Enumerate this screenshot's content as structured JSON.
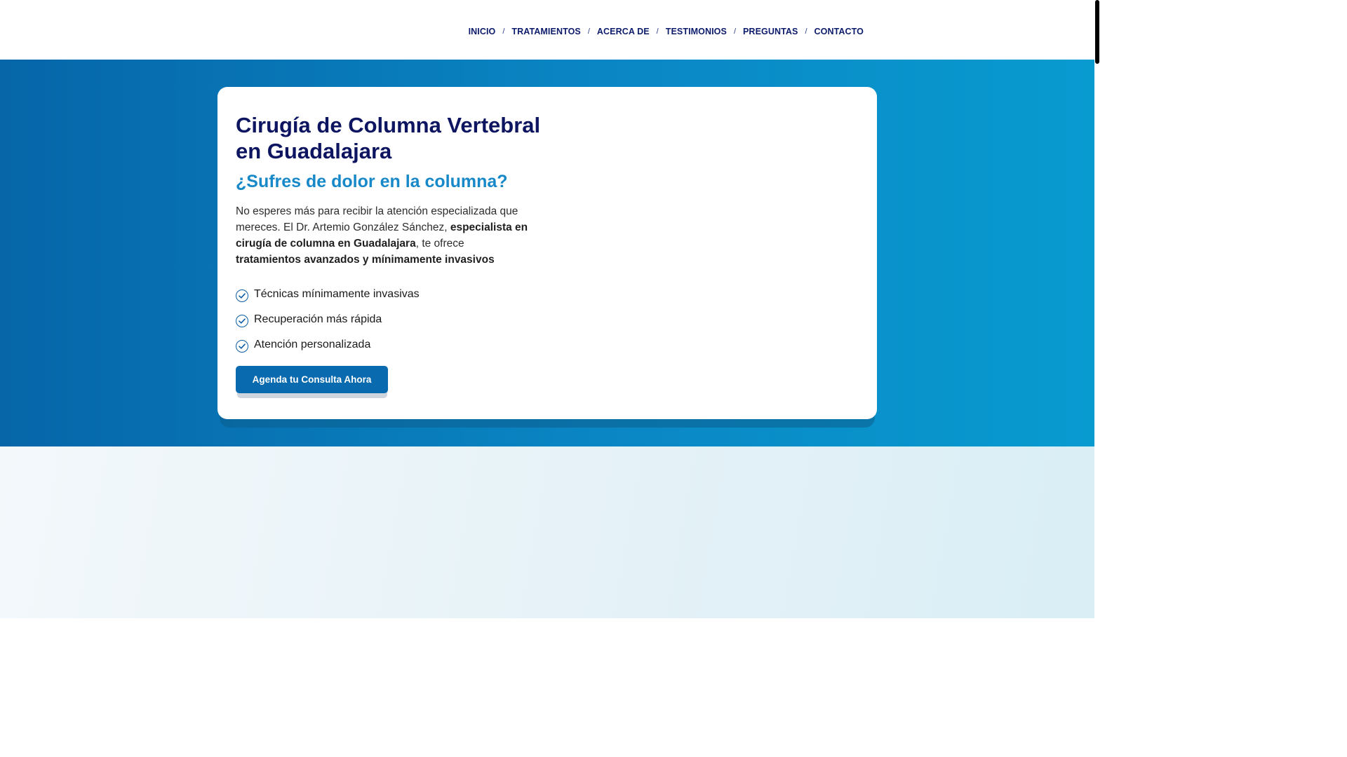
{
  "nav": {
    "items": [
      {
        "label": "INICIO"
      },
      {
        "label": "TRATAMIENTOS"
      },
      {
        "label": "ACERCA DE"
      },
      {
        "label": "TESTIMONIOS"
      },
      {
        "label": "PREGUNTAS"
      },
      {
        "label": "CONTACTO"
      }
    ],
    "separator": "/"
  },
  "hero": {
    "title": "Cirugía de Columna Vertebral en Guadalajara",
    "subtitle": "¿Sufres de dolor en la columna?",
    "body": {
      "p1": "No esperes más para recibir la atención especializada que mereces. El Dr. Artemio González Sánchez, ",
      "b1": "especialista en cirugía de columna en Guadalajara",
      "p2": ", te ofrece ",
      "b2": "tratamientos avanzados y mínimamente invasivos"
    },
    "features": [
      {
        "text": "Técnicas mínimamente invasivas",
        "icon": "check-circle-icon"
      },
      {
        "text": "Recuperación más rápida",
        "icon": "check-circle-icon"
      },
      {
        "text": "Atención personalizada",
        "icon": "check-circle-icon"
      }
    ],
    "cta_label": "Agenda tu Consulta Ahora"
  },
  "colors": {
    "nav_text": "#0d1b6b",
    "title": "#0d1560",
    "subtitle": "#1788c8",
    "cta": "#0a6ab0",
    "hero_gradient_start": "#0666a8",
    "hero_gradient_end": "#089bd0"
  }
}
